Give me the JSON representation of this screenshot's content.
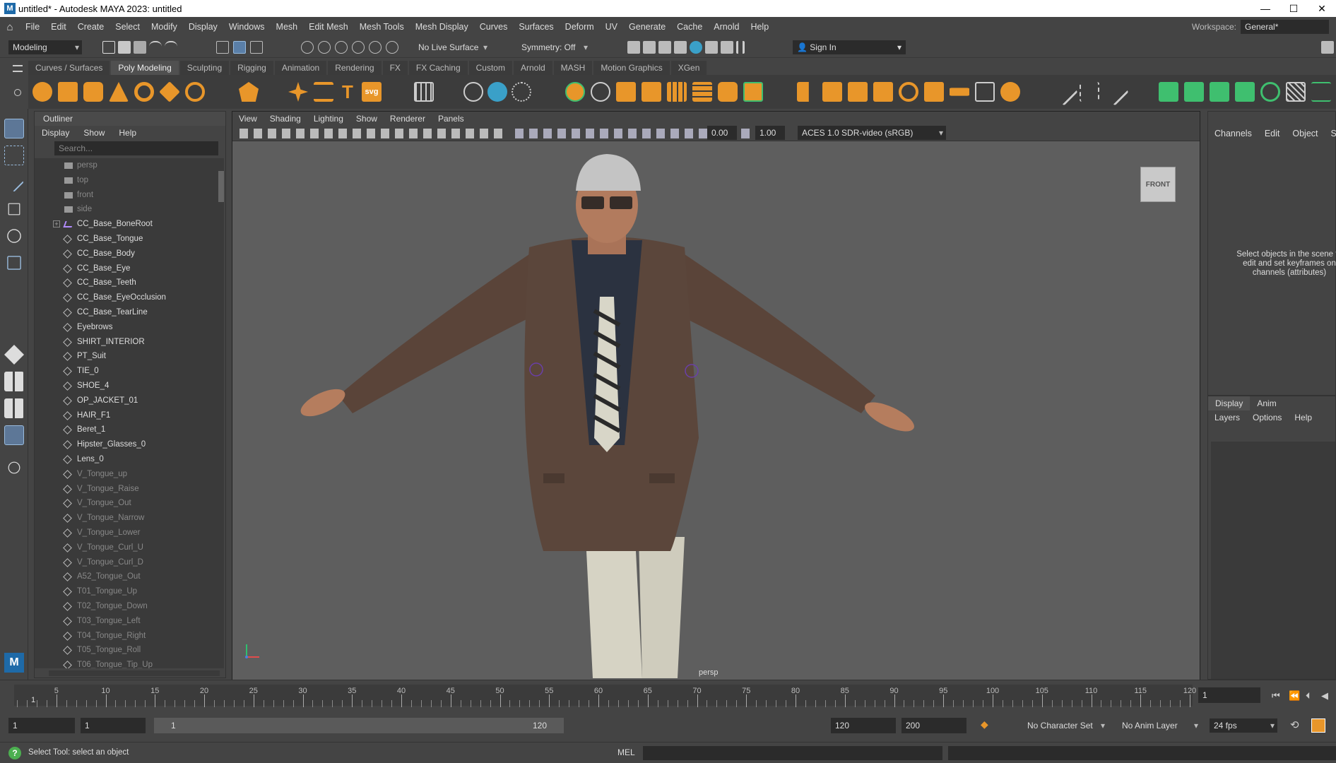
{
  "window": {
    "title": "untitled* - Autodesk MAYA 2023: untitled",
    "logo_letter": "M",
    "controls": [
      "—",
      "☐",
      "✕"
    ]
  },
  "menubar": {
    "home_icon": "home-icon",
    "items": [
      "File",
      "Edit",
      "Create",
      "Select",
      "Modify",
      "Display",
      "Windows",
      "Mesh",
      "Edit Mesh",
      "Mesh Tools",
      "Mesh Display",
      "Curves",
      "Surfaces",
      "Deform",
      "UV",
      "Generate",
      "Cache",
      "Arnold",
      "Help"
    ],
    "workspace_label": "Workspace:",
    "workspace_value": "General*"
  },
  "statusline": {
    "menuset": "Modeling",
    "live_surface": "No Live Surface",
    "symmetry": "Symmetry: Off",
    "sign_in": "Sign In"
  },
  "shelf": {
    "tabs": [
      "Curves / Surfaces",
      "Poly Modeling",
      "Sculpting",
      "Rigging",
      "Animation",
      "Rendering",
      "FX",
      "FX Caching",
      "Custom",
      "Arnold",
      "MASH",
      "Motion Graphics",
      "XGen"
    ],
    "active_tab": "Poly Modeling",
    "accent_orange": "#e8962a",
    "accent_green": "#3fbf6f",
    "text_tool_glyph": "T",
    "svg_tool_glyph": "svg"
  },
  "outliner": {
    "title": "Outliner",
    "menu": [
      "Display",
      "Show",
      "Help"
    ],
    "search_placeholder": "Search...",
    "items": [
      {
        "name": "persp",
        "type": "cam",
        "dim": true
      },
      {
        "name": "top",
        "type": "cam",
        "dim": true
      },
      {
        "name": "front",
        "type": "cam",
        "dim": true
      },
      {
        "name": "side",
        "type": "cam",
        "dim": true
      },
      {
        "name": "CC_Base_BoneRoot",
        "type": "joint",
        "dim": false,
        "expandable": true
      },
      {
        "name": "CC_Base_Tongue",
        "type": "mesh",
        "dim": false
      },
      {
        "name": "CC_Base_Body",
        "type": "mesh",
        "dim": false
      },
      {
        "name": "CC_Base_Eye",
        "type": "mesh",
        "dim": false
      },
      {
        "name": "CC_Base_Teeth",
        "type": "mesh",
        "dim": false
      },
      {
        "name": "CC_Base_EyeOcclusion",
        "type": "mesh",
        "dim": false
      },
      {
        "name": "CC_Base_TearLine",
        "type": "mesh",
        "dim": false
      },
      {
        "name": "Eyebrows",
        "type": "mesh",
        "dim": false
      },
      {
        "name": "SHIRT_INTERIOR",
        "type": "mesh",
        "dim": false
      },
      {
        "name": "PT_Suit",
        "type": "mesh",
        "dim": false
      },
      {
        "name": "TIE_0",
        "type": "mesh",
        "dim": false
      },
      {
        "name": "SHOE_4",
        "type": "mesh",
        "dim": false
      },
      {
        "name": "OP_JACKET_01",
        "type": "mesh",
        "dim": false
      },
      {
        "name": "HAIR_F1",
        "type": "mesh",
        "dim": false
      },
      {
        "name": "Beret_1",
        "type": "mesh",
        "dim": false
      },
      {
        "name": "Hipster_Glasses_0",
        "type": "mesh",
        "dim": false
      },
      {
        "name": "Lens_0",
        "type": "mesh",
        "dim": false
      },
      {
        "name": "V_Tongue_up",
        "type": "mesh",
        "dim": true
      },
      {
        "name": "V_Tongue_Raise",
        "type": "mesh",
        "dim": true
      },
      {
        "name": "V_Tongue_Out",
        "type": "mesh",
        "dim": true
      },
      {
        "name": "V_Tongue_Narrow",
        "type": "mesh",
        "dim": true
      },
      {
        "name": "V_Tongue_Lower",
        "type": "mesh",
        "dim": true
      },
      {
        "name": "V_Tongue_Curl_U",
        "type": "mesh",
        "dim": true
      },
      {
        "name": "V_Tongue_Curl_D",
        "type": "mesh",
        "dim": true
      },
      {
        "name": "A52_Tongue_Out",
        "type": "mesh",
        "dim": true
      },
      {
        "name": "T01_Tongue_Up",
        "type": "mesh",
        "dim": true
      },
      {
        "name": "T02_Tongue_Down",
        "type": "mesh",
        "dim": true
      },
      {
        "name": "T03_Tongue_Left",
        "type": "mesh",
        "dim": true
      },
      {
        "name": "T04_Tongue_Right",
        "type": "mesh",
        "dim": true
      },
      {
        "name": "T05_Tongue_Roll",
        "type": "mesh",
        "dim": true
      },
      {
        "name": "T06_Tongue_Tip_Up",
        "type": "mesh",
        "dim": true
      }
    ]
  },
  "viewport": {
    "panel_menu": [
      "View",
      "Shading",
      "Lighting",
      "Show",
      "Renderer",
      "Panels"
    ],
    "exposure": "0.00",
    "gamma": "1.00",
    "color_space": "ACES 1.0 SDR-video (sRGB)",
    "viewcube_label": "FRONT",
    "camera_label": "persp"
  },
  "channelbox": {
    "menu": [
      "Channels",
      "Edit",
      "Object",
      "Sho"
    ],
    "message": "Select objects in the scene to edit and set keyframes on channels (attributes)"
  },
  "layer_editor": {
    "tabs": [
      "Display",
      "Anim"
    ],
    "active_tab": "Display",
    "menu": [
      "Layers",
      "Options",
      "Help"
    ]
  },
  "timeslider": {
    "labels": [
      5,
      10,
      15,
      20,
      25,
      30,
      35,
      40,
      45,
      50,
      55,
      60,
      65,
      70,
      75,
      80,
      85,
      90,
      95,
      100,
      105,
      110,
      115,
      120
    ],
    "current_frame": "1",
    "current_field": "1"
  },
  "range": {
    "start": "1",
    "playback_start": "1",
    "slider_start": "1",
    "slider_end": "120",
    "playback_end": "120",
    "end": "200",
    "character_set": "No Character Set",
    "anim_layer": "No Anim Layer",
    "fps": "24 fps"
  },
  "helpline": {
    "message": "Select Tool: select an object",
    "mel_label": "MEL"
  }
}
